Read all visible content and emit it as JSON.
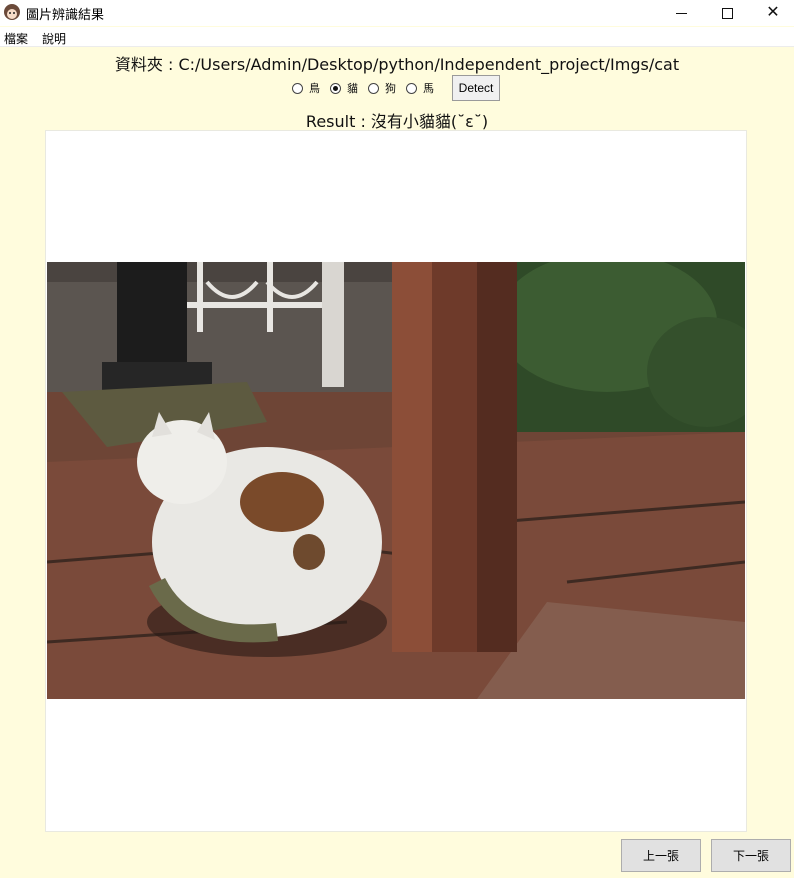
{
  "window": {
    "title": "圖片辨識結果"
  },
  "menu": {
    "items": [
      "檔案",
      "說明"
    ]
  },
  "folder": {
    "text": "資料夾 : C:/Users/Admin/Desktop/python/Independent_project/Imgs/cat"
  },
  "classes": {
    "options": [
      "鳥",
      "貓",
      "狗",
      "馬"
    ],
    "selected": "貓",
    "detect_label": "Detect"
  },
  "result": {
    "text": "Result : 沒有小貓貓(˘ε˘)"
  },
  "navigation": {
    "prev_label": "上一張",
    "next_label": "下一張"
  },
  "colors": {
    "background": "#fffcdd",
    "canvas": "#ffffff"
  }
}
